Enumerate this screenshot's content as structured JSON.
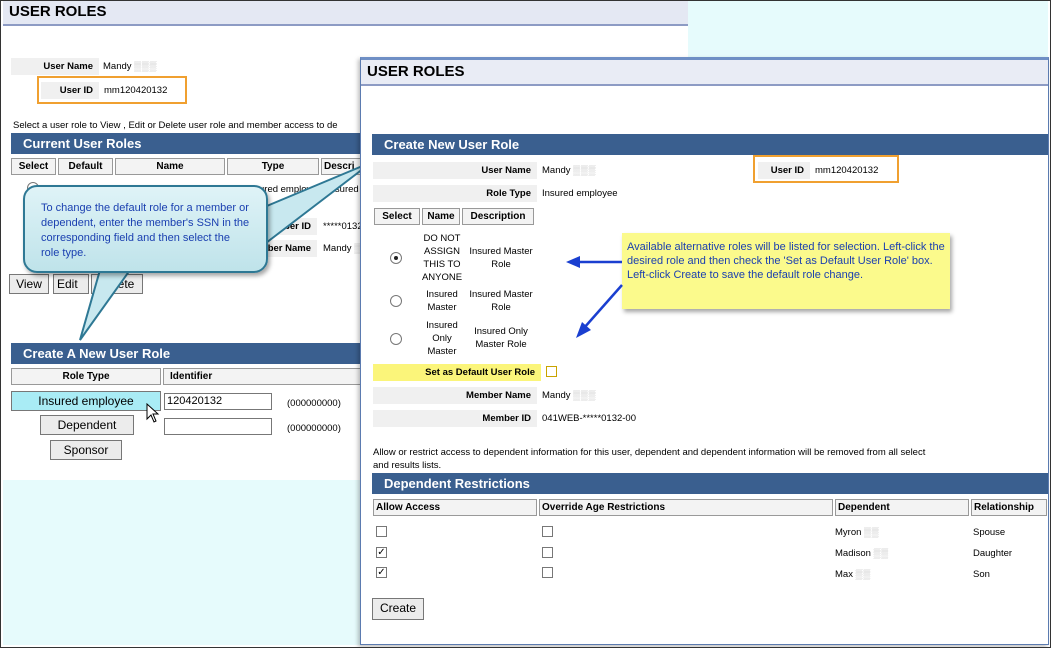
{
  "background": {
    "title": "USER ROLES",
    "user_name_label": "User Name",
    "user_name_value": "Mandy",
    "user_id_label": "User ID",
    "user_id_value": "mm120420132",
    "instruction": "Select a user role to View , Edit or Delete user role and member access to de",
    "current_roles_header": "Current User Roles",
    "columns": [
      "Select",
      "Default",
      "Name",
      "Type",
      "Descri"
    ],
    "row_type_fragment": "ured employee",
    "row_desc_fragment": "Insured M",
    "member_id_label": "mber ID",
    "member_id_value": "*****0132",
    "member_name_label": "ber Name",
    "member_name_value": "Mandy",
    "buttons": {
      "view": "View",
      "edit": "Edit",
      "delete": "Delete"
    },
    "create_header": "Create A New User Role",
    "role_type_col": "Role Type",
    "identifier_col": "Identifier",
    "role_buttons": {
      "insured": "Insured employee",
      "dependent": "Dependent",
      "sponsor": "Sponsor"
    },
    "identifier_value": "120420132",
    "identifier_placeholder": "",
    "format_hint": "(000000000)"
  },
  "modal": {
    "title": "USER ROLES",
    "create_header": "Create New User Role",
    "user_name_label": "User Name",
    "user_name_value": "Mandy",
    "user_id_label": "User ID",
    "user_id_value": "mm120420132",
    "role_type_label": "Role Type",
    "role_type_value": "Insured employee",
    "columns": [
      "Select",
      "Name",
      "Description"
    ],
    "roles": [
      {
        "name": "DO NOT ASSIGN THIS TO ANYONE",
        "description": "Insured Master Role",
        "selected": true
      },
      {
        "name": "Insured Master",
        "description": "Insured Master Role",
        "selected": false
      },
      {
        "name": "Insured Only Master",
        "description": "Insured Only Master Role",
        "selected": false
      }
    ],
    "default_role_label": "Set as Default User Role",
    "member_name_label": "Member Name",
    "member_name_value": "Mandy",
    "member_id_label": "Member ID",
    "member_id_value": "041WEB-*****0132-00",
    "access_note_1": "Allow or restrict access to dependent information for this user, dependent and dependent information will be removed from all select",
    "access_note_2": "and results lists.",
    "dependent_header": "Dependent Restrictions",
    "dep_columns": [
      "Allow Access",
      "Override Age Restrictions",
      "Dependent",
      "Relationship"
    ],
    "dependents": [
      {
        "name": "Myron",
        "relationship": "Spouse",
        "allow": false,
        "override": false
      },
      {
        "name": "Madison",
        "relationship": "Daughter",
        "allow": true,
        "override": false
      },
      {
        "name": "Max",
        "relationship": "Son",
        "allow": true,
        "override": false
      }
    ],
    "create_button": "Create"
  },
  "callouts": {
    "blue": "To change the default role for a member or dependent, enter the member's SSN in the corresponding field and then select the role type.",
    "yellow": "Available alternative roles will be listed for selection. Left-click the desired role and then check the 'Set as Default User Role' box.  Left-click Create to save the default role change."
  },
  "colors": {
    "section_header": "#3a5f8f",
    "highlight_box": "#f0a030",
    "callout_yellow": "#fbfa8c",
    "callout_text": "#1a3fb0",
    "role_button_active": "#a9ecf5"
  }
}
